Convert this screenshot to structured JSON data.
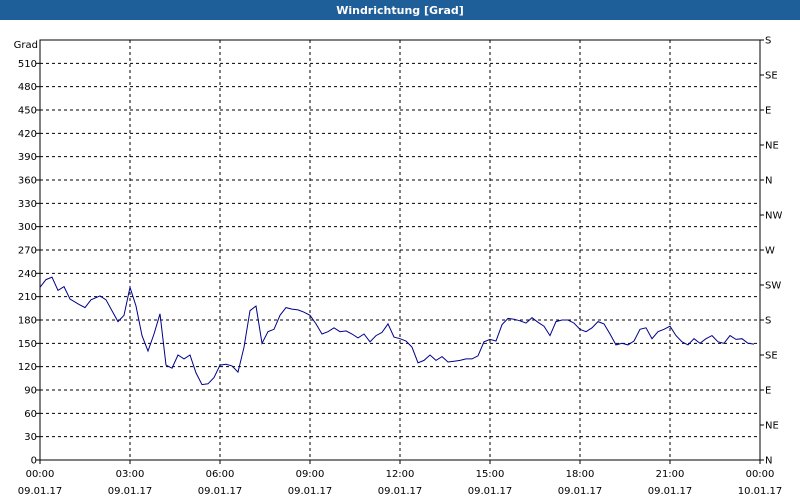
{
  "window": {
    "title": "Windrichtung [Grad]"
  },
  "chart_data": {
    "type": "line",
    "title": "Windrichtung [Grad]",
    "ylabel": "Grad",
    "ylim": [
      0,
      540
    ],
    "y_ticks": [
      0,
      30,
      60,
      90,
      120,
      150,
      180,
      210,
      240,
      270,
      300,
      330,
      360,
      390,
      420,
      450,
      480,
      510
    ],
    "right_axis_labels": [
      "N",
      "NE",
      "E",
      "SE",
      "S",
      "SW",
      "W",
      "NW",
      "N",
      "NE",
      "E",
      "SE",
      "S"
    ],
    "xlim_hours": [
      0,
      24
    ],
    "x_ticks": [
      {
        "time": "00:00",
        "date": "09.01.17"
      },
      {
        "time": "03:00",
        "date": "09.01.17"
      },
      {
        "time": "06:00",
        "date": "09.01.17"
      },
      {
        "time": "09:00",
        "date": "09.01.17"
      },
      {
        "time": "12:00",
        "date": "09.01.17"
      },
      {
        "time": "15:00",
        "date": "09.01.17"
      },
      {
        "time": "18:00",
        "date": "09.01.17"
      },
      {
        "time": "21:00",
        "date": "09.01.17"
      },
      {
        "time": "00:00",
        "date": "10.01.17"
      }
    ],
    "grid": true,
    "series_color": "#00008b",
    "series": [
      {
        "x": [
          0.0,
          0.2,
          0.4,
          0.6,
          0.8,
          1.0,
          1.3,
          1.5,
          1.7,
          2.0,
          2.2,
          2.4,
          2.6,
          2.8,
          3.0,
          3.2,
          3.4,
          3.6,
          3.8,
          4.0,
          4.2,
          4.4,
          4.6,
          4.8,
          5.0,
          5.2,
          5.4,
          5.6,
          5.8,
          6.0,
          6.2,
          6.4,
          6.6,
          6.8,
          7.0,
          7.2,
          7.4,
          7.6,
          7.8,
          8.0,
          8.2,
          8.4,
          8.6,
          8.8,
          9.0,
          9.2,
          9.4,
          9.6,
          9.8,
          10.0,
          10.2,
          10.4,
          10.6,
          10.8,
          11.0,
          11.2,
          11.4,
          11.6,
          11.8,
          12.0,
          12.2,
          12.4,
          12.6,
          12.8,
          13.0,
          13.2,
          13.4,
          13.6,
          13.8,
          14.0,
          14.2,
          14.4,
          14.6,
          14.8,
          15.0,
          15.2,
          15.4,
          15.6,
          15.8,
          16.0,
          16.2,
          16.4,
          16.6,
          16.8,
          17.0,
          17.2,
          17.4,
          17.6,
          17.8,
          18.0,
          18.2,
          18.4,
          18.6,
          18.8,
          19.0,
          19.2,
          19.4,
          19.6,
          19.8,
          20.0,
          20.2,
          20.4,
          20.6,
          20.8,
          21.0,
          21.2,
          21.4,
          21.6,
          21.8,
          22.0,
          22.2,
          22.4,
          22.6,
          22.8,
          23.0,
          23.2,
          23.4,
          23.6,
          23.8
        ],
        "y": [
          222,
          232,
          235,
          218,
          223,
          207,
          200,
          196,
          206,
          211,
          206,
          192,
          178,
          186,
          222,
          198,
          160,
          140,
          162,
          188,
          122,
          118,
          135,
          130,
          135,
          112,
          97,
          98,
          106,
          122,
          123,
          121,
          113,
          145,
          192,
          198,
          150,
          165,
          168,
          186,
          196,
          194,
          193,
          190,
          186,
          175,
          162,
          165,
          170,
          165,
          166,
          162,
          157,
          162,
          152,
          160,
          164,
          175,
          158,
          156,
          153,
          145,
          125,
          128,
          135,
          128,
          133,
          126,
          127,
          128,
          130,
          130,
          134,
          152,
          155,
          153,
          174,
          182,
          181,
          179,
          176,
          183,
          177,
          172,
          160,
          178,
          180,
          180,
          176,
          168,
          165,
          170,
          178,
          175,
          162,
          148,
          150,
          148,
          153,
          168,
          170,
          156,
          165,
          168,
          172,
          160,
          152,
          148,
          156,
          150,
          156,
          160,
          152,
          150,
          160,
          155,
          156,
          150,
          149
        ]
      }
    ]
  }
}
